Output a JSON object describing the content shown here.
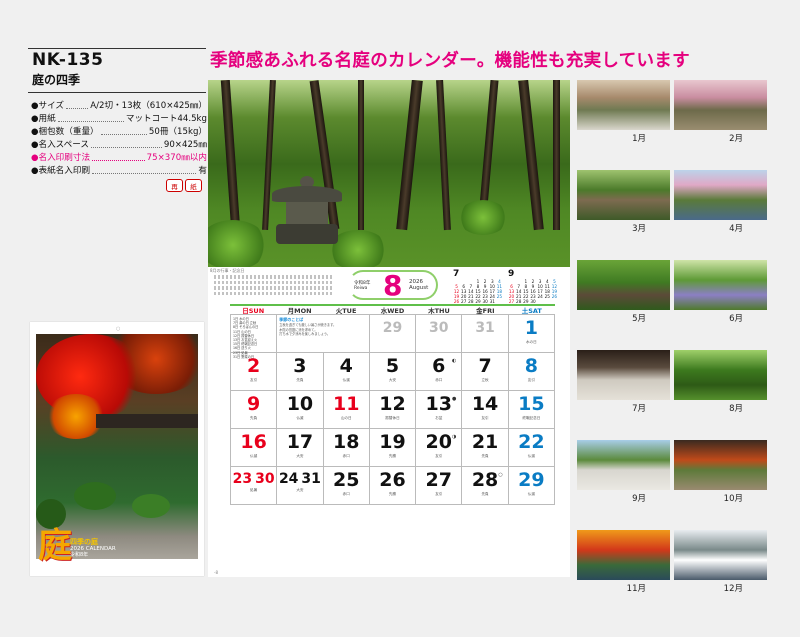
{
  "product": {
    "code": "NK-135",
    "name": "庭の四季",
    "specs": [
      {
        "k": "●サイズ",
        "v": "A/2切・13枚（610×425㎜）",
        "highlight": false
      },
      {
        "k": "●用紙",
        "v": "マットコート44.5kg",
        "highlight": false
      },
      {
        "k": "●梱包数（重量）",
        "v": "50冊（15kg）",
        "highlight": false
      },
      {
        "k": "●名入スペース",
        "v": "90×425㎜",
        "highlight": false
      },
      {
        "k": "●名入印刷寸法",
        "v": "75×370㎜以内",
        "highlight": true
      },
      {
        "k": "●表紙名入印刷",
        "v": "有",
        "highlight": false
      }
    ],
    "eco_icons": [
      "再",
      "紙"
    ]
  },
  "cover": {
    "kanji": "庭",
    "title": "四季の庭",
    "sub": "2026 CALENDAR",
    "caption": "令和8年"
  },
  "headline": "季節感あふれる名庭のカレンダー。機能性も充実しています",
  "calendar": {
    "month": "8",
    "year_label": "2026",
    "month_en": "August",
    "era_label": "令和8年",
    "era_sub": "Reiwa",
    "small_note": "8月の行事・記念日",
    "weekdays": [
      {
        "label": "日SUN",
        "kind": "sun"
      },
      {
        "label": "月MON",
        "kind": ""
      },
      {
        "label": "火TUE",
        "kind": ""
      },
      {
        "label": "水WED",
        "kind": ""
      },
      {
        "label": "木THU",
        "kind": ""
      },
      {
        "label": "金FRI",
        "kind": ""
      },
      {
        "label": "土SAT",
        "kind": "sat"
      }
    ],
    "prev_mini": {
      "month": "7",
      "rows": [
        [
          "",
          "",
          "",
          "1",
          "2",
          "3",
          "4"
        ],
        [
          "5",
          "6",
          "7",
          "8",
          "9",
          "10",
          "11"
        ],
        [
          "12",
          "13",
          "14",
          "15",
          "16",
          "17",
          "18"
        ],
        [
          "19",
          "20",
          "21",
          "22",
          "23",
          "24",
          "25"
        ],
        [
          "26",
          "27",
          "28",
          "29",
          "30",
          "31",
          ""
        ]
      ]
    },
    "next_mini": {
      "month": "9",
      "rows": [
        [
          "",
          "",
          "1",
          "2",
          "3",
          "4",
          "5"
        ],
        [
          "6",
          "7",
          "8",
          "9",
          "10",
          "11",
          "12"
        ],
        [
          "13",
          "14",
          "15",
          "16",
          "17",
          "18",
          "19"
        ],
        [
          "20",
          "21",
          "22",
          "23",
          "24",
          "25",
          "26"
        ],
        [
          "27",
          "28",
          "29",
          "30",
          "",
          "",
          ""
        ]
      ]
    },
    "info_lines": [
      "1日 水の日",
      "7日 鼻の日 立秋",
      "8日 そろばんの日",
      "11日 山の日",
      "12日 振替休日",
      "13日 お盆迎え火",
      "15日 終戦記念日",
      "16日 送り火",
      "23日 処暑",
      "31日 野菜の日"
    ],
    "wide_title": "季節のことば",
    "wide_lines": [
      "立秋を過ぎても厳しい暑さが続きます。",
      "木陰の苔庭に涼を求めて。",
      "打ち水で夕涼みを楽しみましょう。"
    ],
    "week1": [
      {
        "n": "29",
        "c": "grey",
        "sub": ""
      },
      {
        "n": "30",
        "c": "grey",
        "sub": ""
      },
      {
        "n": "31",
        "c": "grey",
        "sub": ""
      },
      {
        "n": "1",
        "c": "blue",
        "sub": "水の日"
      }
    ],
    "weeks": [
      [
        {
          "n": "2",
          "c": "red",
          "sub": "友引",
          "moon": ""
        },
        {
          "n": "3",
          "c": "",
          "sub": "先負",
          "moon": ""
        },
        {
          "n": "4",
          "c": "",
          "sub": "仏滅",
          "moon": ""
        },
        {
          "n": "5",
          "c": "",
          "sub": "大安",
          "moon": ""
        },
        {
          "n": "6",
          "c": "",
          "sub": "赤口",
          "moon": "◐"
        },
        {
          "n": "7",
          "c": "",
          "sub": "立秋",
          "moon": ""
        },
        {
          "n": "8",
          "c": "blue",
          "sub": "友引",
          "moon": ""
        }
      ],
      [
        {
          "n": "9",
          "c": "red",
          "sub": "先負",
          "moon": ""
        },
        {
          "n": "10",
          "c": "",
          "sub": "仏滅",
          "moon": ""
        },
        {
          "n": "11",
          "c": "red",
          "sub": "山の日",
          "moon": ""
        },
        {
          "n": "12",
          "c": "",
          "sub": "振替休日",
          "moon": ""
        },
        {
          "n": "13",
          "c": "",
          "sub": "お盆",
          "moon": "●"
        },
        {
          "n": "14",
          "c": "",
          "sub": "友引",
          "moon": ""
        },
        {
          "n": "15",
          "c": "blue",
          "sub": "終戦記念日",
          "moon": ""
        }
      ],
      [
        {
          "n": "16",
          "c": "red",
          "sub": "仏滅",
          "moon": ""
        },
        {
          "n": "17",
          "c": "",
          "sub": "大安",
          "moon": ""
        },
        {
          "n": "18",
          "c": "",
          "sub": "赤口",
          "moon": ""
        },
        {
          "n": "19",
          "c": "",
          "sub": "先勝",
          "moon": ""
        },
        {
          "n": "20",
          "c": "",
          "sub": "友引",
          "moon": "◑"
        },
        {
          "n": "21",
          "c": "",
          "sub": "先負",
          "moon": ""
        },
        {
          "n": "22",
          "c": "blue",
          "sub": "仏滅",
          "moon": ""
        }
      ],
      [
        {
          "pair": [
            "23",
            "30"
          ],
          "pairc": [
            "red",
            "red"
          ],
          "sub": "処暑"
        },
        {
          "pair": [
            "24",
            "31"
          ],
          "pairc": [
            "",
            ""
          ],
          "sub": "大安"
        },
        {
          "n": "25",
          "c": "",
          "sub": "赤口",
          "moon": ""
        },
        {
          "n": "26",
          "c": "",
          "sub": "先勝",
          "moon": ""
        },
        {
          "n": "27",
          "c": "",
          "sub": "友引",
          "moon": ""
        },
        {
          "n": "28",
          "c": "",
          "sub": "先負",
          "moon": "○"
        },
        {
          "n": "29",
          "c": "blue",
          "sub": "仏滅",
          "moon": ""
        }
      ]
    ]
  },
  "thumbnails": [
    {
      "label": "1月"
    },
    {
      "label": "2月"
    },
    {
      "label": "3月"
    },
    {
      "label": "4月"
    },
    {
      "label": "5月"
    },
    {
      "label": "6月"
    },
    {
      "label": "7月"
    },
    {
      "label": "8月"
    },
    {
      "label": "9月"
    },
    {
      "label": "10月"
    },
    {
      "label": "11月"
    },
    {
      "label": "12月"
    }
  ],
  "colors": {
    "accent": "#e5007e",
    "sunday": "#e8001c",
    "saturday": "#0a7cc4",
    "rule": "#5fbf4a"
  }
}
